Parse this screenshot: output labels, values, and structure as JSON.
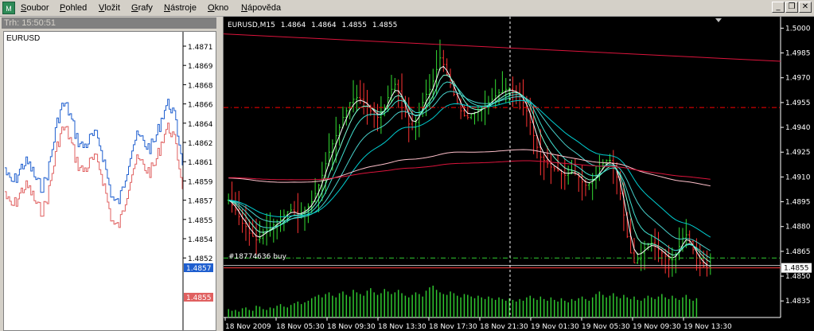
{
  "menu": {
    "items": [
      "Soubor",
      "Pohled",
      "Vložit",
      "Grafy",
      "Nástroje",
      "Okno",
      "Nápověda"
    ],
    "win_buttons": [
      "_",
      "❐",
      "✕"
    ]
  },
  "tick_chart": {
    "title": "Trh: 15:50:51",
    "symbol": "EURUSD",
    "price_labels": [
      "1.4871",
      "1.4869",
      "1.4868",
      "1.4866",
      "1.4864",
      "1.4862",
      "1.4861",
      "1.4859",
      "1.4857",
      "1.4855",
      "1.4854",
      "1.4852"
    ],
    "ask_price": "1.4857",
    "bid_price": "1.4855",
    "ask_color": "#1f5fcf",
    "bid_color": "#e06060"
  },
  "chart_data": {
    "type": "candlestick",
    "symbol": "EURUSD,M15",
    "ohlc": [
      "1.4864",
      "1.4864",
      "1.4855",
      "1.4855"
    ],
    "y_ticks": [
      "1.5000",
      "1.4985",
      "1.4970",
      "1.4955",
      "1.4940",
      "1.4925",
      "1.4910",
      "1.4895",
      "1.4880",
      "1.4865",
      "1.4850",
      "1.4835"
    ],
    "ylim": [
      1.4825,
      1.5005
    ],
    "x_ticks": [
      "18 Nov 2009",
      "18 Nov 05:30",
      "18 Nov 09:30",
      "18 Nov 13:30",
      "18 Nov 17:30",
      "18 Nov 21:30",
      "19 Nov 01:30",
      "19 Nov 05:30",
      "19 Nov 09:30",
      "19 Nov 13:30"
    ],
    "current_price": "1.4855",
    "order_label": "#18774636 buy",
    "order_price": 1.4861,
    "stop_level": 1.4952,
    "bid_line": 1.4855,
    "closes": [
      1.4896,
      1.4893,
      1.489,
      1.4886,
      1.4882,
      1.488,
      1.4876,
      1.4874,
      1.4872,
      1.4873,
      1.4876,
      1.4878,
      1.4879,
      1.4881,
      1.4883,
      1.4884,
      1.4887,
      1.4889,
      1.489,
      1.4889,
      1.4887,
      1.4888,
      1.489,
      1.4892,
      1.4895,
      1.49,
      1.4905,
      1.4911,
      1.4918,
      1.4925,
      1.493,
      1.4935,
      1.494,
      1.4946,
      1.495,
      1.4955,
      1.4957,
      1.4958,
      1.4957,
      1.4955,
      1.4953,
      1.495,
      1.4948,
      1.4946,
      1.4948,
      1.4952,
      1.4958,
      1.4963,
      1.4966,
      1.4962,
      1.4956,
      1.4949,
      1.4942,
      1.494,
      1.4943,
      1.4949,
      1.4955,
      1.496,
      1.4963,
      1.4968,
      1.4975,
      1.4982,
      1.4978,
      1.4972,
      1.4966,
      1.496,
      1.4955,
      1.495,
      1.4947,
      1.4946,
      1.4948,
      1.4949,
      1.495,
      1.4952,
      1.4953,
      1.4955,
      1.4957,
      1.4959,
      1.4961,
      1.4962,
      1.4963,
      1.4963,
      1.4962,
      1.4961,
      1.4959,
      1.4955,
      1.495,
      1.4943,
      1.4935,
      1.4928,
      1.4922,
      1.492,
      1.4918,
      1.4916,
      1.4915,
      1.4914,
      1.4912,
      1.4911,
      1.4912,
      1.4913,
      1.4912,
      1.491,
      1.4907,
      1.4905,
      1.4906,
      1.4908,
      1.4911,
      1.4915,
      1.4918,
      1.492,
      1.492,
      1.4917,
      1.491,
      1.49,
      1.4887,
      1.4874,
      1.4864,
      1.4858,
      1.486,
      1.4864,
      1.4867,
      1.4869,
      1.487,
      1.4868,
      1.4866,
      1.4864,
      1.4862,
      1.486,
      1.486,
      1.4863,
      1.4868,
      1.4873,
      1.4875,
      1.4871,
      1.4866,
      1.4861,
      1.4858,
      1.4856,
      1.4855,
      1.4855
    ],
    "volumes": [
      10,
      8,
      9,
      7,
      11,
      12,
      9,
      8,
      14,
      13,
      10,
      9,
      12,
      11,
      14,
      16,
      13,
      12,
      15,
      17,
      19,
      16,
      18,
      20,
      23,
      25,
      27,
      24,
      28,
      30,
      26,
      24,
      29,
      31,
      27,
      25,
      33,
      30,
      28,
      26,
      32,
      35,
      30,
      27,
      29,
      34,
      31,
      28,
      30,
      33,
      29,
      26,
      24,
      27,
      30,
      28,
      25,
      32,
      36,
      38,
      33,
      30,
      28,
      27,
      31,
      29,
      26,
      24,
      28,
      27,
      25,
      23,
      26,
      24,
      22,
      25,
      23,
      21,
      24,
      22,
      20,
      23,
      21,
      19,
      22,
      20,
      24,
      26,
      23,
      21,
      25,
      22,
      20,
      24,
      21,
      19,
      23,
      20,
      18,
      22,
      20,
      23,
      25,
      22,
      20,
      24,
      28,
      31,
      27,
      24,
      26,
      29,
      25,
      23,
      27,
      24,
      22,
      25,
      21,
      20,
      23,
      26,
      24,
      22,
      25,
      28,
      24,
      22,
      26,
      23,
      21,
      24,
      27,
      22,
      20,
      23
    ]
  }
}
